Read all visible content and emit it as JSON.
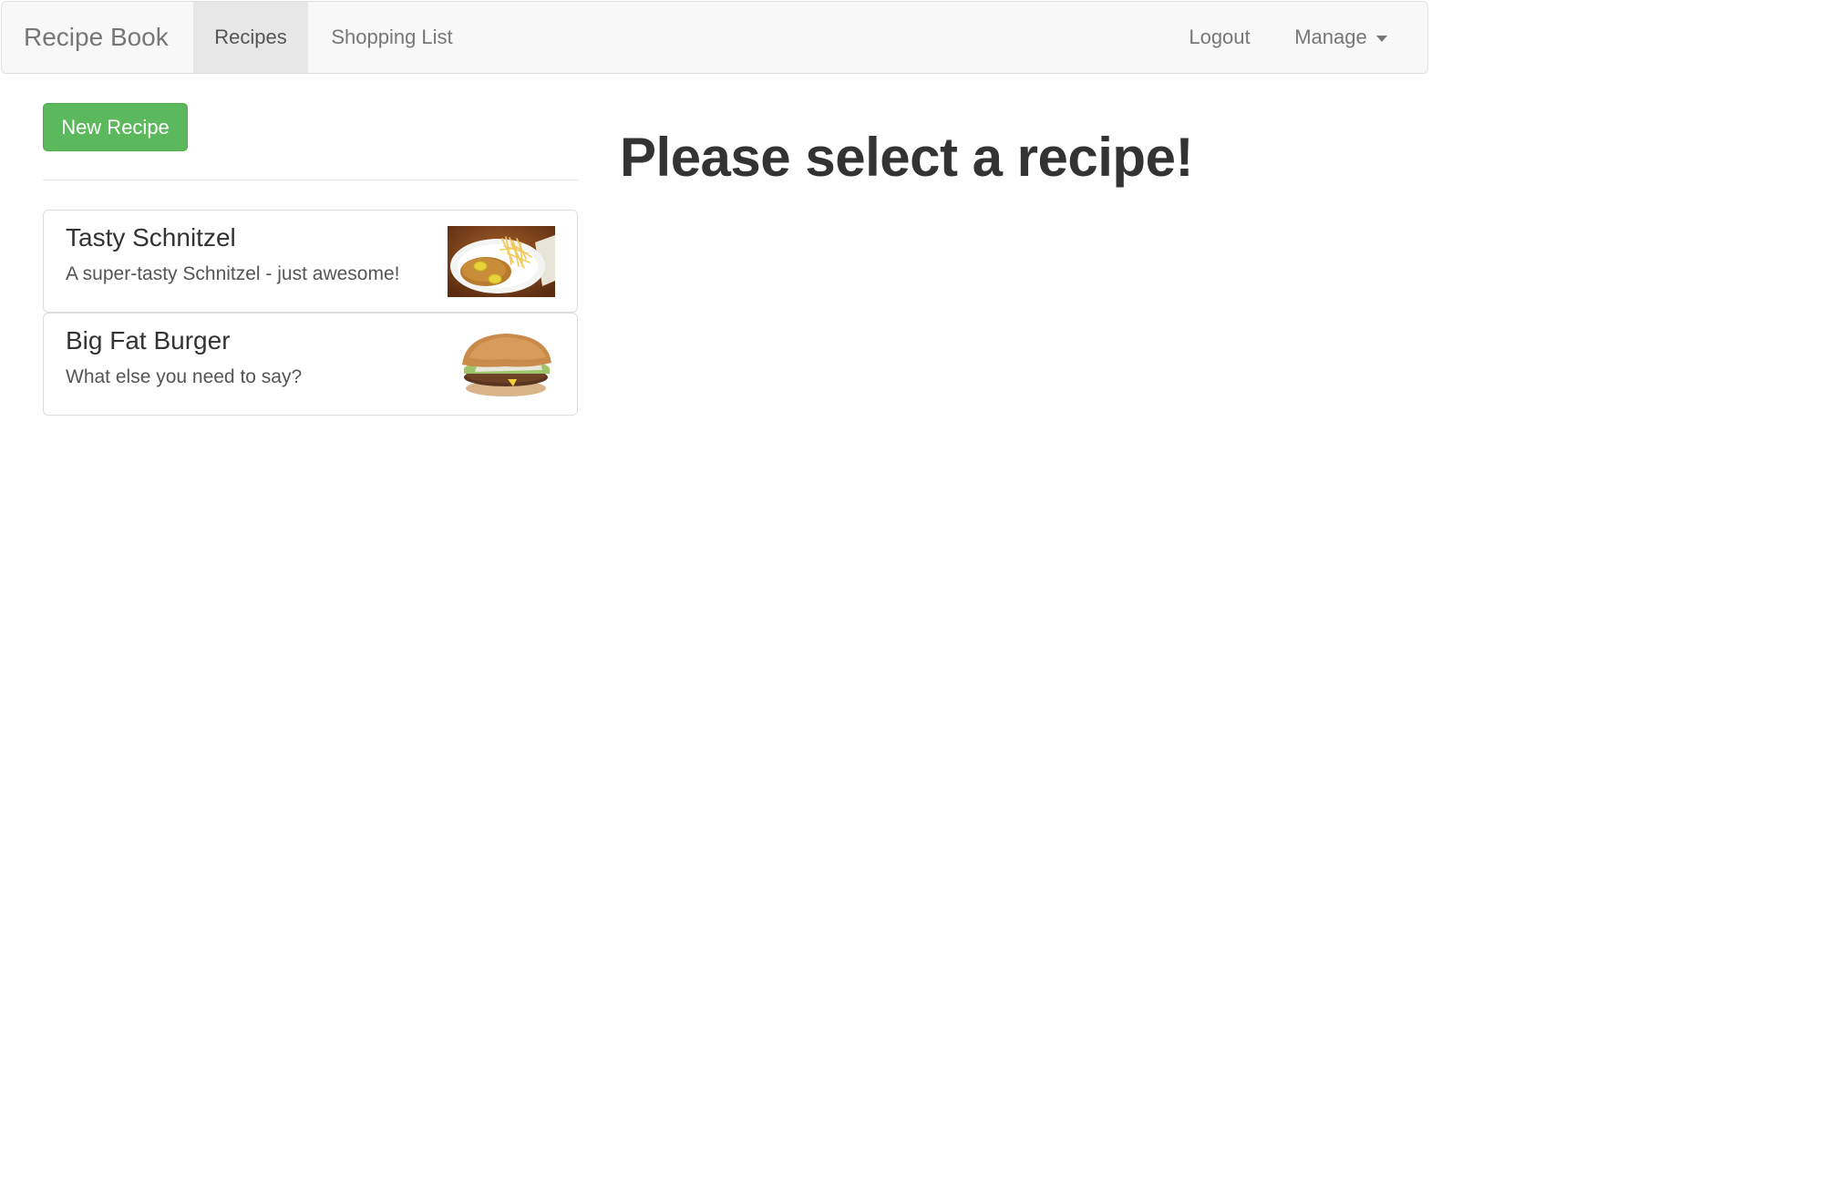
{
  "navbar": {
    "brand": "Recipe Book",
    "links": {
      "recipes": "Recipes",
      "shopping_list": "Shopping List",
      "logout": "Logout",
      "manage": "Manage"
    },
    "active_link": "Recipes"
  },
  "recipes_panel": {
    "new_recipe_label": "New Recipe",
    "items": [
      {
        "name": "Tasty Schnitzel",
        "description": "A super-tasty Schnitzel - just awesome!",
        "image_icon": "schnitzel-photo"
      },
      {
        "name": "Big Fat Burger",
        "description": "What else you need to say?",
        "image_icon": "burger-photo"
      }
    ]
  },
  "detail_panel": {
    "placeholder_heading": "Please select a recipe!"
  },
  "colors": {
    "navbar_bg": "#f8f8f8",
    "navbar_active_bg": "#e7e7e7",
    "success_button": "#5cb85c",
    "text_dark": "#333333",
    "text_muted": "#777777"
  }
}
